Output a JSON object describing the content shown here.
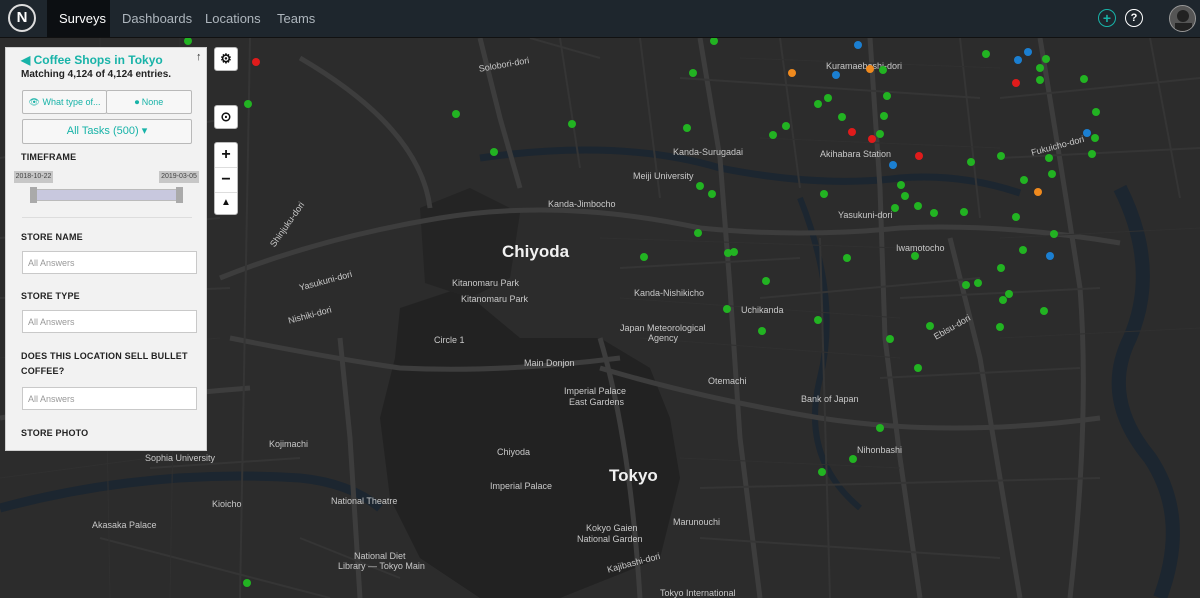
{
  "app": {
    "logo_letter": "N"
  },
  "nav": {
    "items": [
      {
        "label": "Surveys"
      },
      {
        "label": "Dashboards"
      },
      {
        "label": "Locations"
      },
      {
        "label": "Teams"
      }
    ]
  },
  "header_actions": {
    "add_icon": "+",
    "help_icon": "?"
  },
  "panel": {
    "title": "Coffee Shops in Tokyo",
    "matching": "Matching 4,124 of 4,124 entries.",
    "filter_question": "What type of...",
    "tag_filter": "None",
    "tasks_button": "All Tasks (500) ▾",
    "timeframe_label": "TIMEFRAME",
    "timeframe_start": "2018-10-22",
    "timeframe_end": "2019-03-05",
    "store_name_label": "STORE NAME",
    "store_name_placeholder": "All Answers",
    "store_type_label": "STORE TYPE",
    "store_type_placeholder": "All Answers",
    "bullet_coffee_label_1": "DOES THIS LOCATION SELL BULLET",
    "bullet_coffee_label_2": "COFFEE?",
    "bullet_coffee_placeholder": "All Answers",
    "store_photo_label": "STORE PHOTO"
  },
  "map_controls": {
    "zoom_in": "+",
    "zoom_out": "−"
  },
  "map": {
    "labels": {
      "chiyoda": "Chiyoda",
      "tokyo": "Tokyo",
      "kitanomaru1": "Kitanomaru Park",
      "kitanomaru2": "Kitanomaru Park",
      "kanda_surugadai": "Kanda-Surugadai",
      "meiji_univ": "Meiji University",
      "kanda_jimbocho": "Kanda-Jimbocho",
      "akihabara": "Akihabara Station",
      "yasukuni": "Yasukuni-dori",
      "iwamotocho": "Iwamotocho",
      "kanda_nishikicho": "Kanda-Nishikicho",
      "uchikanda": "Uchikanda",
      "jma1": "Japan Meteorological",
      "jma2": "Agency",
      "main_donjon": "Main Donjon",
      "imperial_east1": "Imperial Palace",
      "imperial_east2": "East Gardens",
      "otemachi": "Otemachi",
      "bank_japan": "Bank of Japan",
      "nihonbashi": "Nihonbashi",
      "chiyoda_small": "Chiyoda",
      "imperial_palace": "Imperial Palace",
      "marunouchi": "Marunouchi",
      "kokyo1": "Kokyo Gaien",
      "kokyo2": "National Garden",
      "kojimachi": "Kojimachi",
      "sophia": "Sophia University",
      "kioicho": "Kioicho",
      "national_theatre": "National Theatre",
      "akasaka": "Akasaka Palace",
      "diet1": "National Diet",
      "diet2": "Library — Tokyo Main",
      "tokyo_intl": "Tokyo International",
      "circle1": "Circle 1",
      "kuramaebashi": "Kuramaebashi-dori",
      "ebisu": "Ebisu-dori",
      "fukuicho": "Fukuicho-dori",
      "solobori": "Solobori-dori",
      "shinjuku": "Shinjuku-dori",
      "yasukuni2": "Yasukuni-dori",
      "nishiki": "Nishiki-dori",
      "kajibashi": "Kajibashi-dori"
    },
    "pin_colors": {
      "green": "#22b322",
      "orange": "#f08a1e",
      "blue": "#1b7fd1",
      "red": "#e01b1b"
    }
  }
}
